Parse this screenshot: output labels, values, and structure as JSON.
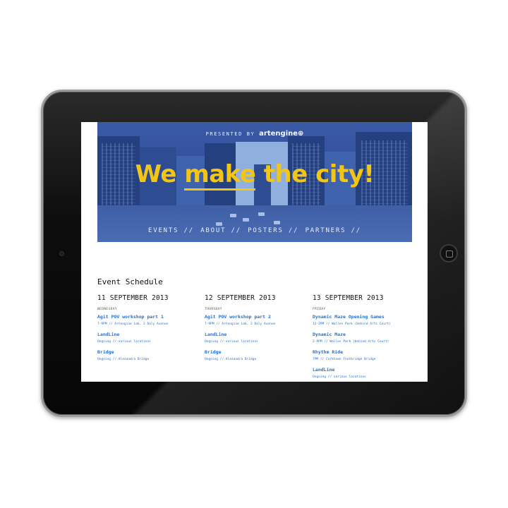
{
  "site": {
    "presented_by": "PRESENTED BY",
    "brand": "artengine",
    "headline_pre": "We ",
    "headline_emph": "make",
    "headline_post": " the city!",
    "nav": [
      "EVENTS //",
      "ABOUT //",
      "POSTERS //",
      "PARTNERS //"
    ]
  },
  "schedule": {
    "title": "Event Schedule",
    "days": [
      {
        "date": "11 SEPTEMBER 2013",
        "weekday": "WEDNESDAY",
        "events": [
          {
            "title": "Agit POV workshop part 1",
            "meta": "7-9PM // Artengine Lab, 2 Daly Avenue"
          },
          {
            "title": "LandLine",
            "meta": "Ongoing // various locations"
          },
          {
            "title": "Bridge",
            "meta": "Ongoing // Alexandra Bridge"
          }
        ]
      },
      {
        "date": "12 SEPTEMBER 2013",
        "weekday": "THURSDAY",
        "events": [
          {
            "title": "Agit POV workshop part 2",
            "meta": "7-9PM // Artengine Lab, 2 Daly Avenue"
          },
          {
            "title": "LandLine",
            "meta": "Ongoing // various locations"
          },
          {
            "title": "Bridge",
            "meta": "Ongoing // Alexandra Bridge"
          }
        ]
      },
      {
        "date": "13 SEPTEMBER 2013",
        "weekday": "FRIDAY",
        "events": [
          {
            "title": "Dynamic Maze Opening Games",
            "meta": "12-2PM // Walles Park (behind Arts Court)"
          },
          {
            "title": "Dynamic Maze",
            "meta": "2-9PM // Walles Park (behind Arts Court)"
          },
          {
            "title": "Rhythm Ride",
            "meta": "7PM // Corktown Footbridge Bridge"
          },
          {
            "title": "LandLine",
            "meta": "Ongoing // various locations"
          }
        ]
      }
    ]
  },
  "colors": {
    "headline": "#f3c516",
    "hero_blue": "#2e4b95",
    "link_blue": "#2b6fc9",
    "device_bezel": "#0d0d0d"
  }
}
